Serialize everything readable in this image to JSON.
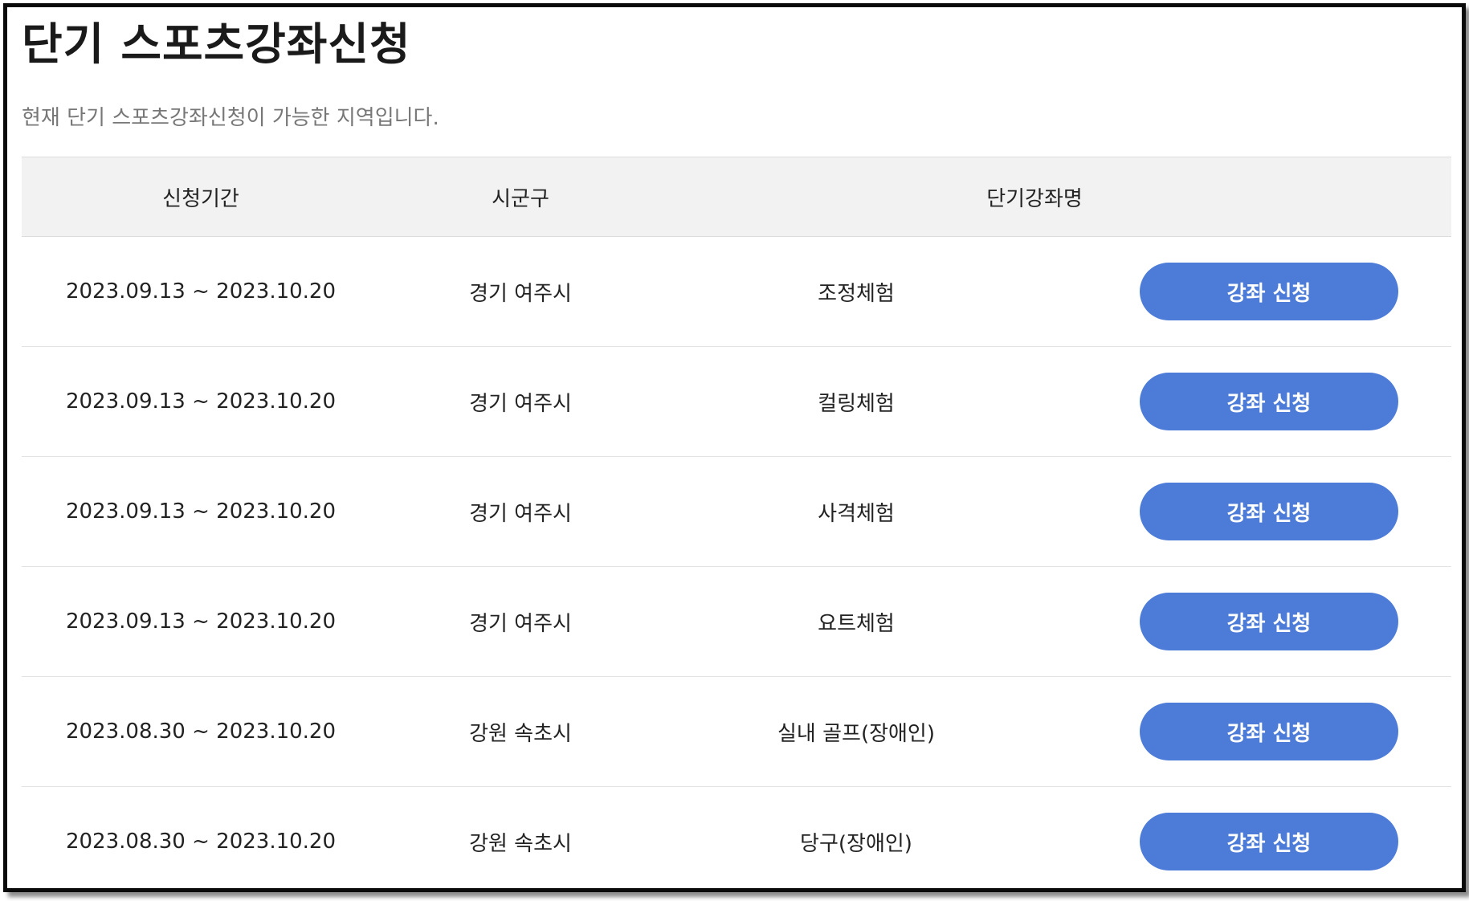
{
  "page": {
    "title": "단기 스포츠강좌신청",
    "subtitle": "현재 단기 스포츠강좌신청이 가능한 지역입니다."
  },
  "table": {
    "headers": {
      "period": "신청기간",
      "region": "시군구",
      "course": "단기강좌명",
      "action": ""
    },
    "rows": [
      {
        "period": "2023.09.13 ~ 2023.10.20",
        "region": "경기 여주시",
        "course": "조정체험",
        "button": "강좌 신청"
      },
      {
        "period": "2023.09.13 ~ 2023.10.20",
        "region": "경기 여주시",
        "course": "컬링체험",
        "button": "강좌 신청"
      },
      {
        "period": "2023.09.13 ~ 2023.10.20",
        "region": "경기 여주시",
        "course": "사격체험",
        "button": "강좌 신청"
      },
      {
        "period": "2023.09.13 ~ 2023.10.20",
        "region": "경기 여주시",
        "course": "요트체험",
        "button": "강좌 신청"
      },
      {
        "period": "2023.08.30 ~ 2023.10.20",
        "region": "강원 속초시",
        "course": "실내 골프(장애인)",
        "button": "강좌 신청"
      },
      {
        "period": "2023.08.30 ~ 2023.10.20",
        "region": "강원 속초시",
        "course": "당구(장애인)",
        "button": "강좌 신청"
      }
    ]
  },
  "colors": {
    "button_bg": "#4d7cd8",
    "header_bg": "#f2f2f2",
    "frame_border": "#0a0a0a"
  }
}
